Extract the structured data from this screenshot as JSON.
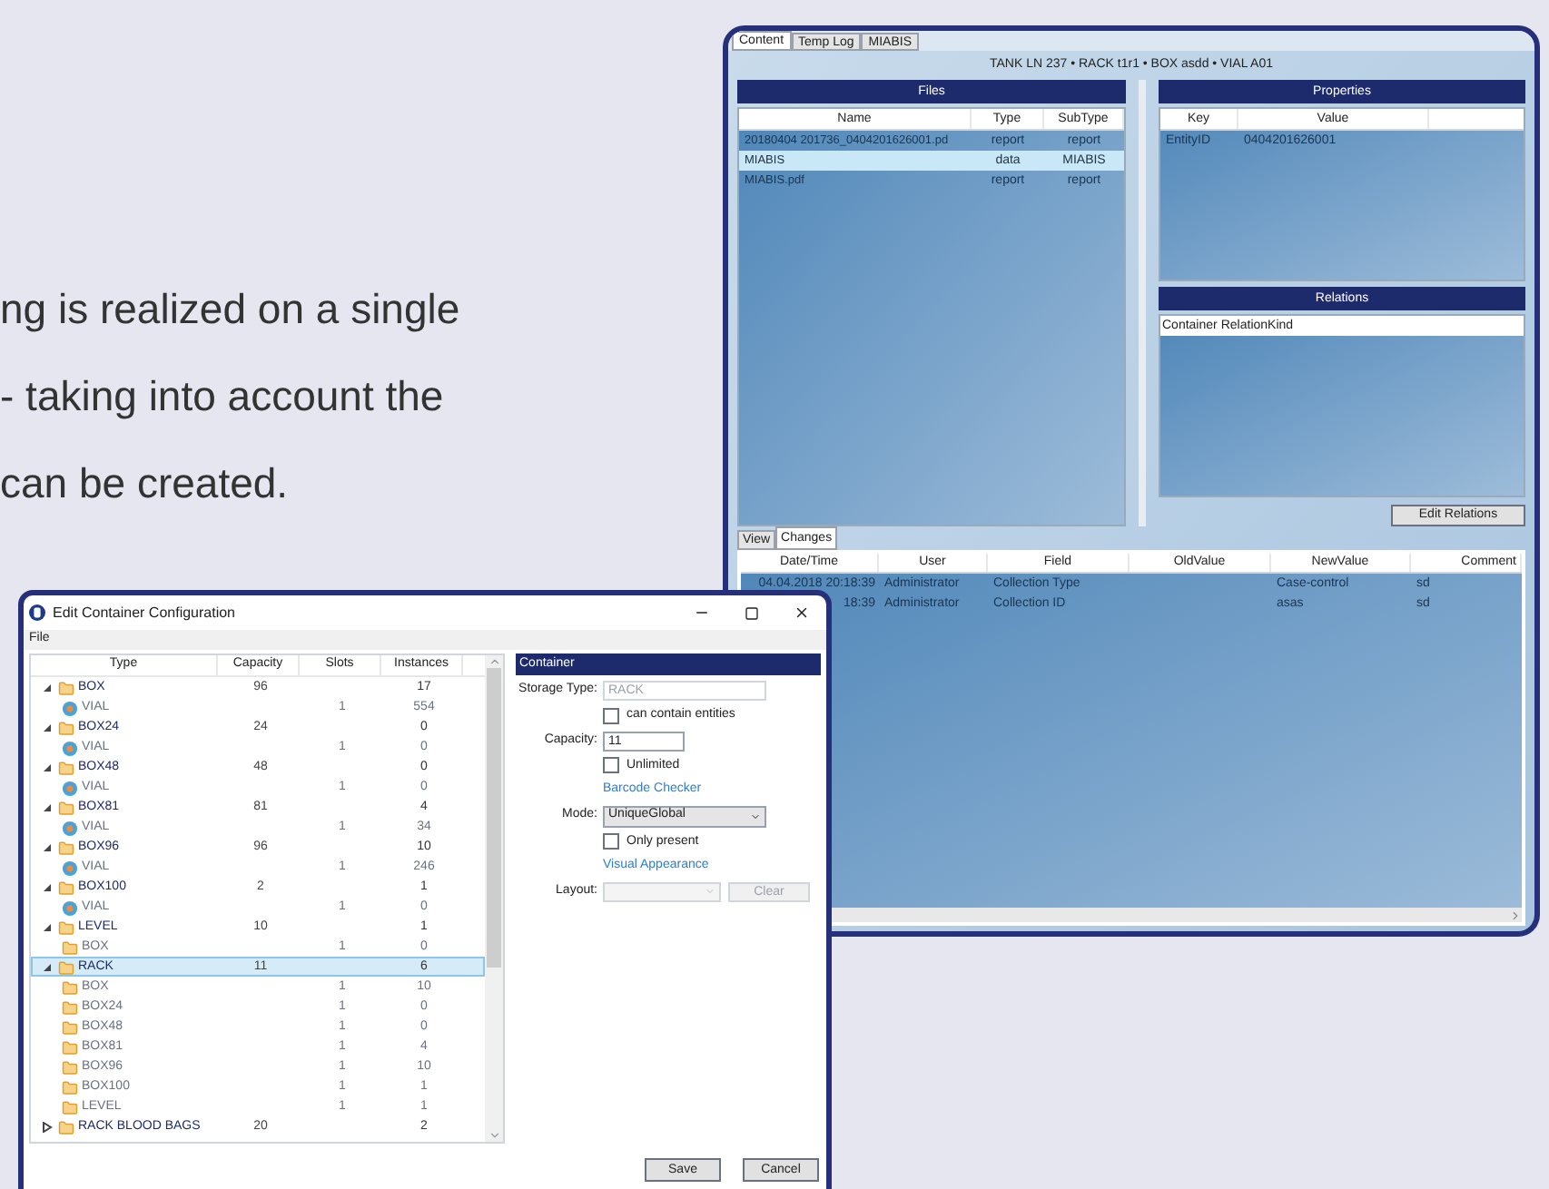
{
  "page_text": {
    "lines": [
      "ng is realized on a single",
      "- taking into account the",
      "can be created."
    ]
  },
  "main_window": {
    "tabs": [
      {
        "label": "Content",
        "selected": true
      },
      {
        "label": "Temp Log",
        "selected": false
      },
      {
        "label": "MIABIS",
        "selected": false
      }
    ],
    "breadcrumb": "TANK LN 237 • RACK t1r1 • BOX asdd • VIAL A01",
    "files": {
      "title": "Files",
      "columns": [
        "Name",
        "Type",
        "SubType"
      ],
      "rows": [
        {
          "cells": [
            "20180404 201736_0404201626001.pd",
            "report",
            "report"
          ],
          "selected": false
        },
        {
          "cells": [
            "MIABIS",
            "data",
            "MIABIS"
          ],
          "selected": true
        },
        {
          "cells": [
            "MIABIS.pdf",
            "report",
            "report"
          ],
          "selected": false
        }
      ]
    },
    "properties": {
      "title": "Properties",
      "columns": [
        "Key",
        "Value"
      ],
      "rows": [
        {
          "cells": [
            "EntityID",
            "0404201626001"
          ]
        }
      ]
    },
    "relations": {
      "title": "Relations",
      "columns": [
        "Container",
        "RelationKind"
      ]
    },
    "edit_relations_button": "Edit Relations",
    "bottom_tabs": [
      {
        "label": "View",
        "selected": false
      },
      {
        "label": "Changes",
        "selected": true
      }
    ],
    "changes": {
      "columns": [
        "Date/Time",
        "User",
        "Field",
        "OldValue",
        "NewValue",
        "Comment"
      ],
      "rows": [
        {
          "cells": [
            "04.04.2018 20:18:39",
            "Administrator",
            "Collection Type",
            "",
            "Case-control",
            "sd"
          ]
        },
        {
          "cells": [
            "18:39",
            "Administrator",
            "Collection ID",
            "",
            "asas",
            "sd"
          ]
        }
      ]
    }
  },
  "dialog": {
    "title": "Edit Container Configuration",
    "menu": [
      "File"
    ],
    "tree": {
      "columns": [
        "Type",
        "Capacity",
        "Slots",
        "Instances"
      ],
      "items": [
        {
          "name": "BOX",
          "kind": "folder",
          "capacity": "96",
          "instances": "17",
          "expanded": true,
          "selected": false,
          "children": [
            {
              "name": "VIAL",
              "kind": "vial",
              "slots": "1",
              "instances": "554",
              "selected": false
            }
          ]
        },
        {
          "name": "BOX24",
          "kind": "folder",
          "capacity": "24",
          "instances": "0",
          "expanded": true,
          "selected": false,
          "children": [
            {
              "name": "VIAL",
              "kind": "vial",
              "slots": "1",
              "instances": "0",
              "selected": false
            }
          ]
        },
        {
          "name": "BOX48",
          "kind": "folder",
          "capacity": "48",
          "instances": "0",
          "expanded": true,
          "selected": false,
          "children": [
            {
              "name": "VIAL",
              "kind": "vial",
              "slots": "1",
              "instances": "0",
              "selected": false
            }
          ]
        },
        {
          "name": "BOX81",
          "kind": "folder",
          "capacity": "81",
          "instances": "4",
          "expanded": true,
          "selected": false,
          "children": [
            {
              "name": "VIAL",
              "kind": "vial",
              "slots": "1",
              "instances": "34",
              "selected": false
            }
          ]
        },
        {
          "name": "BOX96",
          "kind": "folder",
          "capacity": "96",
          "instances": "10",
          "expanded": true,
          "selected": false,
          "children": [
            {
              "name": "VIAL",
              "kind": "vial",
              "slots": "1",
              "instances": "246",
              "selected": false
            }
          ]
        },
        {
          "name": "BOX100",
          "kind": "folder",
          "capacity": "2",
          "instances": "1",
          "expanded": true,
          "selected": false,
          "children": [
            {
              "name": "VIAL",
              "kind": "vial",
              "slots": "1",
              "instances": "0",
              "selected": false
            }
          ]
        },
        {
          "name": "LEVEL",
          "kind": "folder",
          "capacity": "10",
          "instances": "1",
          "expanded": true,
          "selected": false,
          "children": [
            {
              "name": "BOX",
              "kind": "folder",
              "slots": "1",
              "instances": "0",
              "selected": false
            }
          ]
        },
        {
          "name": "RACK",
          "kind": "folder",
          "capacity": "11",
          "instances": "6",
          "expanded": true,
          "selected": true,
          "children": [
            {
              "name": "BOX",
              "kind": "folder",
              "slots": "1",
              "instances": "10",
              "selected": false
            },
            {
              "name": "BOX24",
              "kind": "folder",
              "slots": "1",
              "instances": "0",
              "selected": false
            },
            {
              "name": "BOX48",
              "kind": "folder",
              "slots": "1",
              "instances": "0",
              "selected": false
            },
            {
              "name": "BOX81",
              "kind": "folder",
              "slots": "1",
              "instances": "4",
              "selected": false
            },
            {
              "name": "BOX96",
              "kind": "folder",
              "slots": "1",
              "instances": "10",
              "selected": false
            },
            {
              "name": "BOX100",
              "kind": "folder",
              "slots": "1",
              "instances": "1",
              "selected": false
            },
            {
              "name": "LEVEL",
              "kind": "folder",
              "slots": "1",
              "instances": "1",
              "selected": false
            }
          ]
        },
        {
          "name": "RACK BLOOD BAGS",
          "kind": "folder",
          "capacity": "20",
          "instances": "2",
          "expanded": false,
          "selected": false
        }
      ]
    },
    "container": {
      "title": "Container",
      "storage_type": {
        "label": "Storage Type:",
        "value": "RACK",
        "disabled": true
      },
      "can_contain": {
        "label": "can contain entities",
        "checked": false
      },
      "capacity": {
        "label": "Capacity:",
        "value": "11"
      },
      "unlimited": {
        "label": "Unlimited",
        "checked": false
      },
      "barcode_link": "Barcode Checker",
      "mode": {
        "label": "Mode:",
        "value": "UniqueGlobal"
      },
      "only_present": {
        "label": "Only present",
        "checked": false
      },
      "visual_link": "Visual Appearance",
      "layout": {
        "label": "Layout:",
        "disabled": true
      },
      "clear_button": {
        "label": "Clear",
        "disabled": true
      }
    },
    "buttons": [
      "Save",
      "Cancel"
    ]
  }
}
